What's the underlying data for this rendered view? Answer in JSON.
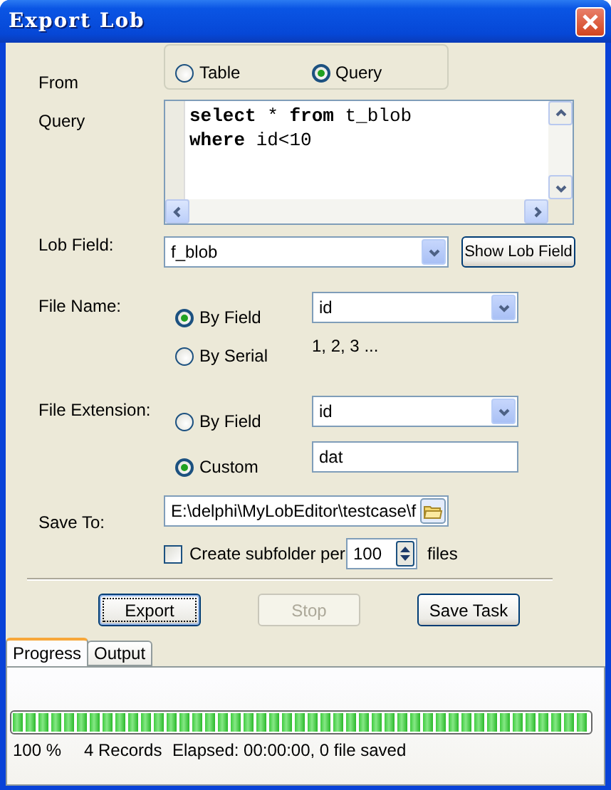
{
  "window": {
    "title": "Export Lob"
  },
  "from": {
    "label": "From",
    "options": [
      {
        "label": "Table",
        "selected": false
      },
      {
        "label": "Query",
        "selected": true
      }
    ]
  },
  "query": {
    "label": "Query",
    "lines": [
      "**select** * **from** t_blob",
      "**where** id<10"
    ]
  },
  "lob_field": {
    "label": "Lob Field:",
    "value": "f_blob",
    "button": "Show Lob Field"
  },
  "file_name": {
    "label": "File Name:",
    "options": [
      {
        "label": "By Field",
        "selected": true,
        "kind": "combo",
        "value": "id"
      },
      {
        "label": "By Serial",
        "selected": false,
        "kind": "text",
        "value": "1, 2, 3 ..."
      }
    ]
  },
  "file_extension": {
    "label": "File Extension:",
    "options": [
      {
        "label": "By Field",
        "selected": false,
        "kind": "combo",
        "value": "id"
      },
      {
        "label": "Custom",
        "selected": true,
        "kind": "input",
        "value": "dat"
      }
    ]
  },
  "save_to": {
    "label": "Save To:",
    "value": "E:\\delphi\\MyLobEditor\\testcase\\f"
  },
  "subfolder": {
    "label": "Create subfolder per",
    "checked": false,
    "count": "100",
    "unit": "files"
  },
  "buttons": [
    {
      "label": "Export",
      "disabled": false,
      "focused": true
    },
    {
      "label": "Stop",
      "disabled": true,
      "focused": false
    },
    {
      "label": "Save Task",
      "disabled": false,
      "focused": false
    }
  ],
  "tabs": [
    {
      "label": "Progress",
      "selected": true
    },
    {
      "label": "Output",
      "selected": false
    }
  ],
  "progress": {
    "level": 1,
    "percent": "100 %",
    "records": "4 Records",
    "elapsed": "Elapsed: 00:00:00, 0 file saved"
  }
}
